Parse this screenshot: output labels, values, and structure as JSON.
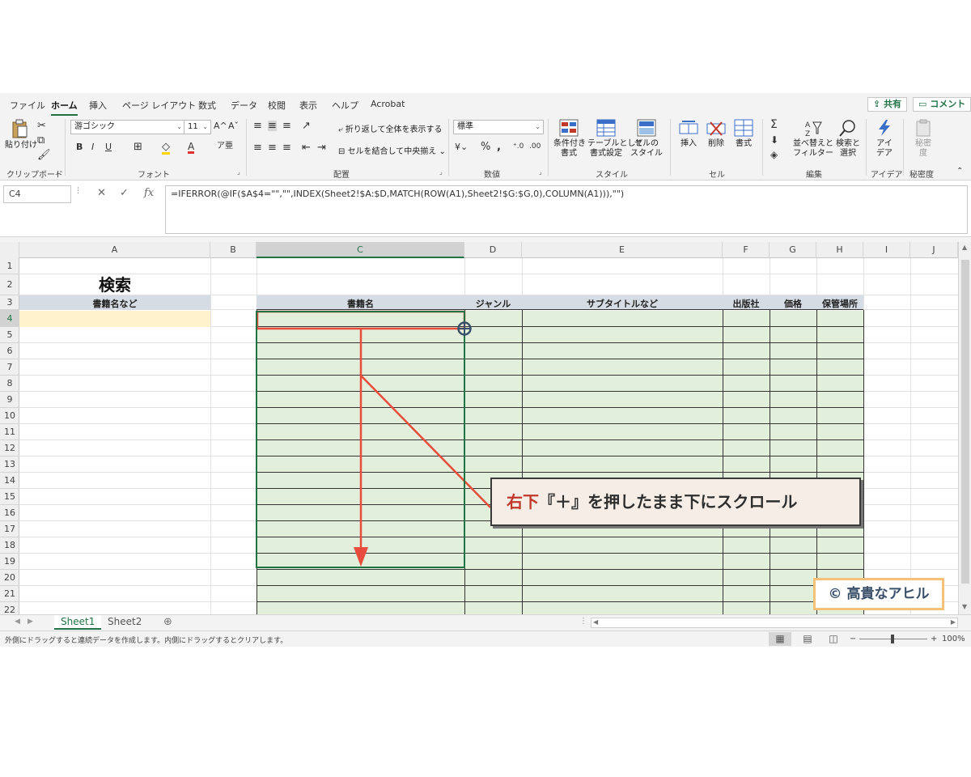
{
  "ribbon": {
    "tabs": [
      "ファイル",
      "ホーム",
      "挿入",
      "ページ レイアウト",
      "数式",
      "データ",
      "校閲",
      "表示",
      "ヘルプ",
      "Acrobat"
    ],
    "share_label": "共有",
    "comment_label": "コメント",
    "clipboard": {
      "paste_label": "貼り付け",
      "group_label": "クリップボード"
    },
    "font": {
      "font_name": "游ゴシック",
      "font_size": "11",
      "group_label": "フォント"
    },
    "alignment": {
      "wrap_text_label": "折り返して全体を表示する",
      "merge_center_label": "セルを結合して中央揃え",
      "group_label": "配置"
    },
    "number": {
      "format": "標準",
      "group_label": "数値"
    },
    "styles": {
      "conditional_label_1": "条件付き",
      "conditional_label_2": "書式",
      "table_label_1": "テーブルとして",
      "table_label_2": "書式設定",
      "cell_style_label_1": "セルの",
      "cell_style_label_2": "スタイル",
      "group_label": "スタイル"
    },
    "cells": {
      "insert_label": "挿入",
      "delete_label": "削除",
      "format_label": "書式",
      "group_label": "セル"
    },
    "editing": {
      "sort_label_1": "並べ替えと",
      "sort_label_2": "フィルター",
      "find_label_1": "検索と",
      "find_label_2": "選択",
      "group_label": "編集"
    },
    "ideas": {
      "label_1": "アイ",
      "label_2": "デア",
      "group_label": "アイデア"
    },
    "sensitivity": {
      "label_1": "秘密",
      "label_2": "度",
      "group_label": "秘密度"
    }
  },
  "formula_bar": {
    "name_box": "C4",
    "formula": "=IFERROR(@IF($A$4=\"\",\"\",INDEX(Sheet2!$A:$D,MATCH(ROW(A1),Sheet2!$G:$G,0),COLUMN(A1))),\"\")"
  },
  "grid": {
    "columns": [
      "A",
      "B",
      "C",
      "D",
      "E",
      "F",
      "G",
      "H",
      "I",
      "J"
    ],
    "selected_column": "C",
    "rows": [
      "1",
      "2",
      "3",
      "4",
      "5",
      "6",
      "7",
      "8",
      "9",
      "10",
      "11",
      "12",
      "13",
      "14",
      "15",
      "16",
      "17",
      "18",
      "19",
      "20",
      "21",
      "22"
    ],
    "selected_row": "4",
    "title": "検索",
    "search_header": "書籍名など",
    "table_headers": [
      "書籍名",
      "ジャンル",
      "サブタイトルなど",
      "出版社",
      "価格",
      "保管場所"
    ]
  },
  "sheets": [
    "Sheet1",
    "Sheet2"
  ],
  "active_sheet": "Sheet1",
  "status": {
    "message": "外側にドラッグすると連続データを作成します。内側にドラッグするとクリアします。",
    "zoom": "100%"
  },
  "annotation": {
    "callout_prefix": "右下",
    "callout_text": "『＋』を押したまま下にスクロール",
    "copyright": "© 高貴なアヒル"
  },
  "colors": {
    "accent": "#217346",
    "annotation_red": "#e74c3c",
    "header_band": "#d6dce4",
    "search_fill": "#fff2cc",
    "table_fill": "#e2efda"
  }
}
